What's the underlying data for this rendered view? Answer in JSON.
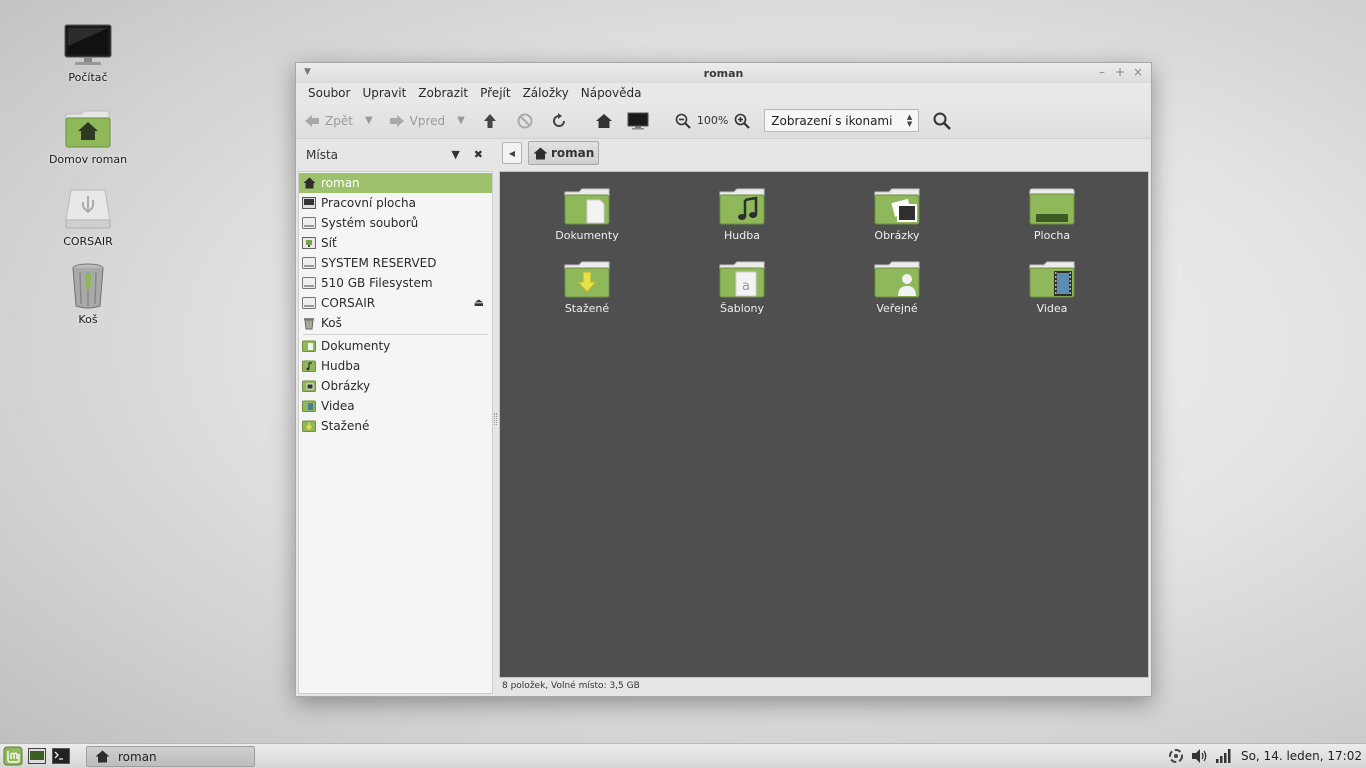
{
  "desktop": {
    "icons": [
      {
        "label": "Počítač",
        "icon": "monitor-icon"
      },
      {
        "label": "Domov roman",
        "icon": "home-folder-icon"
      },
      {
        "label": "CORSAIR",
        "icon": "usb-drive-icon"
      },
      {
        "label": "Koš",
        "icon": "trash-icon"
      }
    ]
  },
  "window": {
    "title": "roman",
    "menu": [
      "Soubor",
      "Upravit",
      "Zobrazit",
      "Přejít",
      "Záložky",
      "Nápověda"
    ],
    "toolbar": {
      "back": "Zpět",
      "forward": "Vpred",
      "zoom": "100%",
      "view_mode": "Zobrazení s ikonami"
    },
    "sidebar": {
      "header": "Místa",
      "devices": [
        {
          "label": "roman",
          "icon": "home-icon",
          "active": true
        },
        {
          "label": "Pracovní plocha",
          "icon": "desktop-icon"
        },
        {
          "label": "Systém souborů",
          "icon": "drive-icon"
        },
        {
          "label": "Síť",
          "icon": "network-icon"
        },
        {
          "label": "SYSTEM RESERVED",
          "icon": "drive-icon"
        },
        {
          "label": "510 GB Filesystem",
          "icon": "drive-icon"
        },
        {
          "label": "CORSAIR",
          "icon": "drive-icon",
          "eject": true
        },
        {
          "label": "Koš",
          "icon": "trash-icon"
        }
      ],
      "bookmarks": [
        {
          "label": "Dokumenty",
          "icon": "folder-documents-icon"
        },
        {
          "label": "Hudba",
          "icon": "folder-music-icon"
        },
        {
          "label": "Obrázky",
          "icon": "folder-pictures-icon"
        },
        {
          "label": "Videa",
          "icon": "folder-videos-icon"
        },
        {
          "label": "Stažené",
          "icon": "folder-downloads-icon"
        }
      ]
    },
    "location": {
      "crumb": "roman"
    },
    "files": [
      {
        "label": "Dokumenty",
        "icon": "folder-documents-icon"
      },
      {
        "label": "Hudba",
        "icon": "folder-music-icon"
      },
      {
        "label": "Obrázky",
        "icon": "folder-pictures-icon"
      },
      {
        "label": "Plocha",
        "icon": "folder-desktop-icon"
      },
      {
        "label": "Stažené",
        "icon": "folder-downloads-icon"
      },
      {
        "label": "Šablony",
        "icon": "folder-templates-icon"
      },
      {
        "label": "Veřejné",
        "icon": "folder-public-icon"
      },
      {
        "label": "Videa",
        "icon": "folder-videos-icon"
      }
    ],
    "status": "8 položek, Volné místo: 3,5 GB"
  },
  "panel": {
    "task_label": "roman",
    "clock": "So, 14. leden, 17:02"
  },
  "colors": {
    "accent": "#9ec26b",
    "folder": "#8fb85a",
    "content_bg": "#4f4f4f"
  }
}
